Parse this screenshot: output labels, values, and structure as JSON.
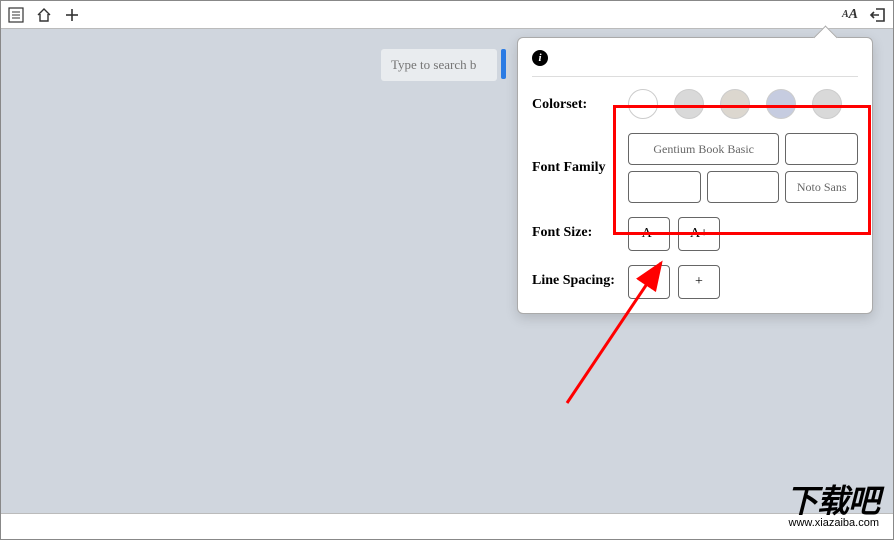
{
  "toolbar": {
    "list_icon": "list",
    "home_icon": "home",
    "add_icon": "add",
    "font_icon": "Aa",
    "exit_icon": "exit"
  },
  "search": {
    "placeholder": "Type to search b"
  },
  "popover": {
    "info_label": "i",
    "colorset_label": "Colorset:",
    "fontfamily_label": "Font Family",
    "fonts": [
      "Gentium Book Basic",
      "",
      "",
      "",
      "Noto Sans"
    ],
    "fontsize_label": "Font Size:",
    "size_minus": "A-",
    "size_plus": "A+",
    "linespacing_label": "Line Spacing:",
    "spacing_minus": "-",
    "spacing_plus": "+"
  },
  "watermark": {
    "big": "下载吧",
    "url": "www.xiazaiba.com"
  }
}
